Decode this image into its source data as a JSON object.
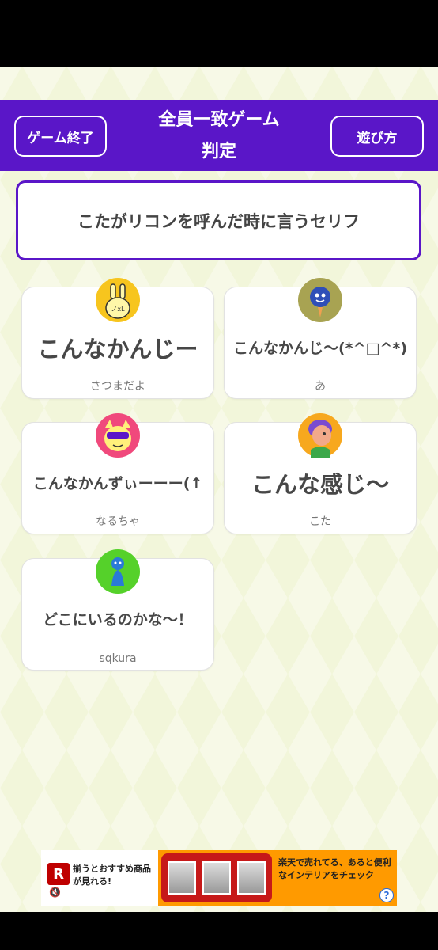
{
  "header": {
    "end_label": "ゲーム終了",
    "title_line1": "全員一致ゲーム",
    "title_line2": "判定",
    "howto_label": "遊び方"
  },
  "question": "こたがリコンを呼んだ時に言うセリフ",
  "answers": [
    {
      "text": "こんなかんじー",
      "player": "さつまだよ",
      "avatar": "rabbit-avatar"
    },
    {
      "text": "こんなかんじ〜(*^□^*)",
      "player": "あ",
      "avatar": "balloon-avatar"
    },
    {
      "text": "こんなかんずぃーーー(↑",
      "player": "なるちゃ",
      "avatar": "cat-sunglasses-avatar"
    },
    {
      "text": "こんな感じ〜",
      "player": "こた",
      "avatar": "girl-avatar"
    },
    {
      "text": "どこにいるのかな〜！",
      "player": "sqkura",
      "avatar": "pawn-avatar"
    }
  ],
  "ad": {
    "logo": "R",
    "left_text": "揃うとおすすめ商品が見れる!",
    "right_text": "楽天で売れてる、あると便利なインテリアをチェック",
    "help": "?"
  },
  "colors": {
    "header": "#5a16c8",
    "background": "#f3f7dc",
    "answer_text": "#474747"
  }
}
